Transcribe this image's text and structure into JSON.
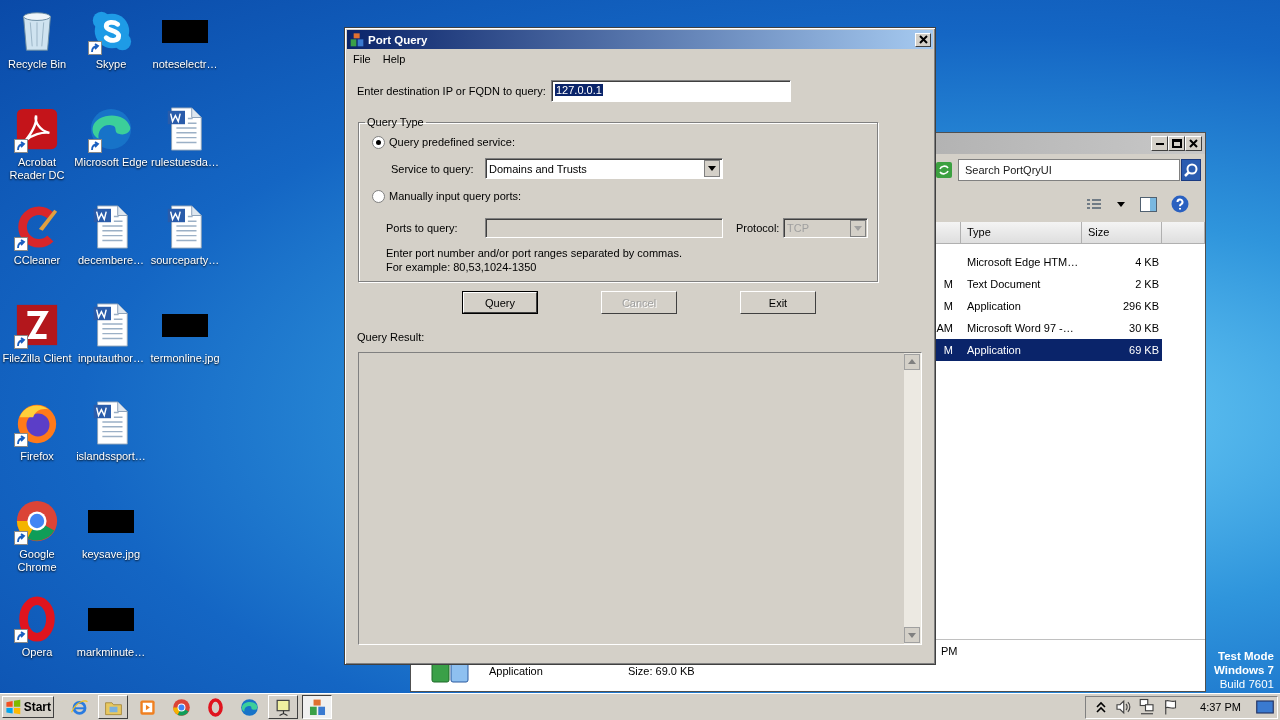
{
  "desktop": {
    "columns": [
      [
        {
          "label": "Recycle Bin",
          "kind": "recycle",
          "shortcut": false
        },
        {
          "label": "Acrobat Reader DC",
          "kind": "acrobat",
          "shortcut": true
        },
        {
          "label": "CCleaner",
          "kind": "ccleaner",
          "shortcut": true
        },
        {
          "label": "FileZilla Client",
          "kind": "filezilla",
          "shortcut": true
        },
        {
          "label": "Firefox",
          "kind": "firefox",
          "shortcut": true
        },
        {
          "label": "Google Chrome",
          "kind": "chrome",
          "shortcut": true
        },
        {
          "label": "Opera",
          "kind": "opera",
          "shortcut": true
        }
      ],
      [
        {
          "label": "Skype",
          "kind": "skype",
          "shortcut": true
        },
        {
          "label": "Microsoft Edge",
          "kind": "edge",
          "shortcut": true
        },
        {
          "label": "decembere…",
          "kind": "word",
          "shortcut": false
        },
        {
          "label": "inputauthor…",
          "kind": "word",
          "shortcut": false
        },
        {
          "label": "islandssport…",
          "kind": "word",
          "shortcut": false
        },
        {
          "label": "keysave.jpg",
          "kind": "redacted",
          "shortcut": false
        },
        {
          "label": "markminute…",
          "kind": "redacted",
          "shortcut": false
        }
      ],
      [
        {
          "label": "noteselectr…",
          "kind": "redacted",
          "shortcut": false
        },
        {
          "label": "rulestuesda…",
          "kind": "word",
          "shortcut": false
        },
        {
          "label": "sourceparty…",
          "kind": "word",
          "shortcut": false
        },
        {
          "label": "termonline.jpg",
          "kind": "redacted",
          "shortcut": false
        }
      ]
    ],
    "system_notice": {
      "title": [
        "Test Mode",
        "Windows 7"
      ],
      "build": "Build 7601"
    }
  },
  "explorer": {
    "search_placeholder": "Search PortQryUI",
    "columns": [
      "Type",
      "Size"
    ],
    "rows": [
      {
        "type": "Microsoft Edge HTM…",
        "size": "4 KB",
        "selected": false
      },
      {
        "date": "M",
        "type": "Text Document",
        "size": "2 KB",
        "selected": false
      },
      {
        "date": "M",
        "type": "Application",
        "size": "296 KB",
        "selected": false
      },
      {
        "date": "AM",
        "type": "Microsoft Word 97 -…",
        "size": "30 KB",
        "selected": false
      },
      {
        "date": "M",
        "type": "Application",
        "size": "69 KB",
        "selected": true
      }
    ],
    "details": {
      "date": "PM",
      "type": "Application",
      "size": "Size: 69.0 KB"
    }
  },
  "port_query": {
    "title": "Port Query",
    "menu": [
      "File",
      "Help"
    ],
    "destination": {
      "label": "Enter destination IP or FQDN to query:",
      "value": "127.0.0.1",
      "selected": true
    },
    "query_type": {
      "legend": "Query Type",
      "options": [
        {
          "label": "Query predefined service:",
          "selected": true
        },
        {
          "label": "Manually input query ports:",
          "selected": false
        }
      ],
      "service": {
        "label": "Service to query:",
        "value": "Domains and Trusts"
      },
      "ports": {
        "label": "Ports to query:",
        "disabled": true
      },
      "protocol": {
        "label": "Protocol:",
        "value": "TCP",
        "disabled": true
      },
      "hint": [
        "Enter port number and/or port ranges separated by commas.",
        "For example: 80,53,1024-1350"
      ]
    },
    "buttons": [
      {
        "label": "Query",
        "disabled": false,
        "default": true
      },
      {
        "label": "Cancel",
        "disabled": true,
        "default": false
      },
      {
        "label": "Exit",
        "disabled": false,
        "default": false
      }
    ],
    "result_label": "Query Result:"
  },
  "taskbar": {
    "start_label": "Start",
    "items": [
      {
        "kind": "ie",
        "running": false,
        "selected": false
      },
      {
        "kind": "folder",
        "running": true,
        "selected": false
      },
      {
        "kind": "media",
        "running": false,
        "selected": false
      },
      {
        "kind": "chrome",
        "running": false,
        "selected": false
      },
      {
        "kind": "opera",
        "running": false,
        "selected": false
      },
      {
        "kind": "edge",
        "running": false,
        "selected": false
      },
      {
        "kind": "presentation",
        "running": true,
        "selected": false
      },
      {
        "kind": "portquery",
        "running": true,
        "selected": true
      }
    ],
    "clock": "4:37 PM"
  }
}
